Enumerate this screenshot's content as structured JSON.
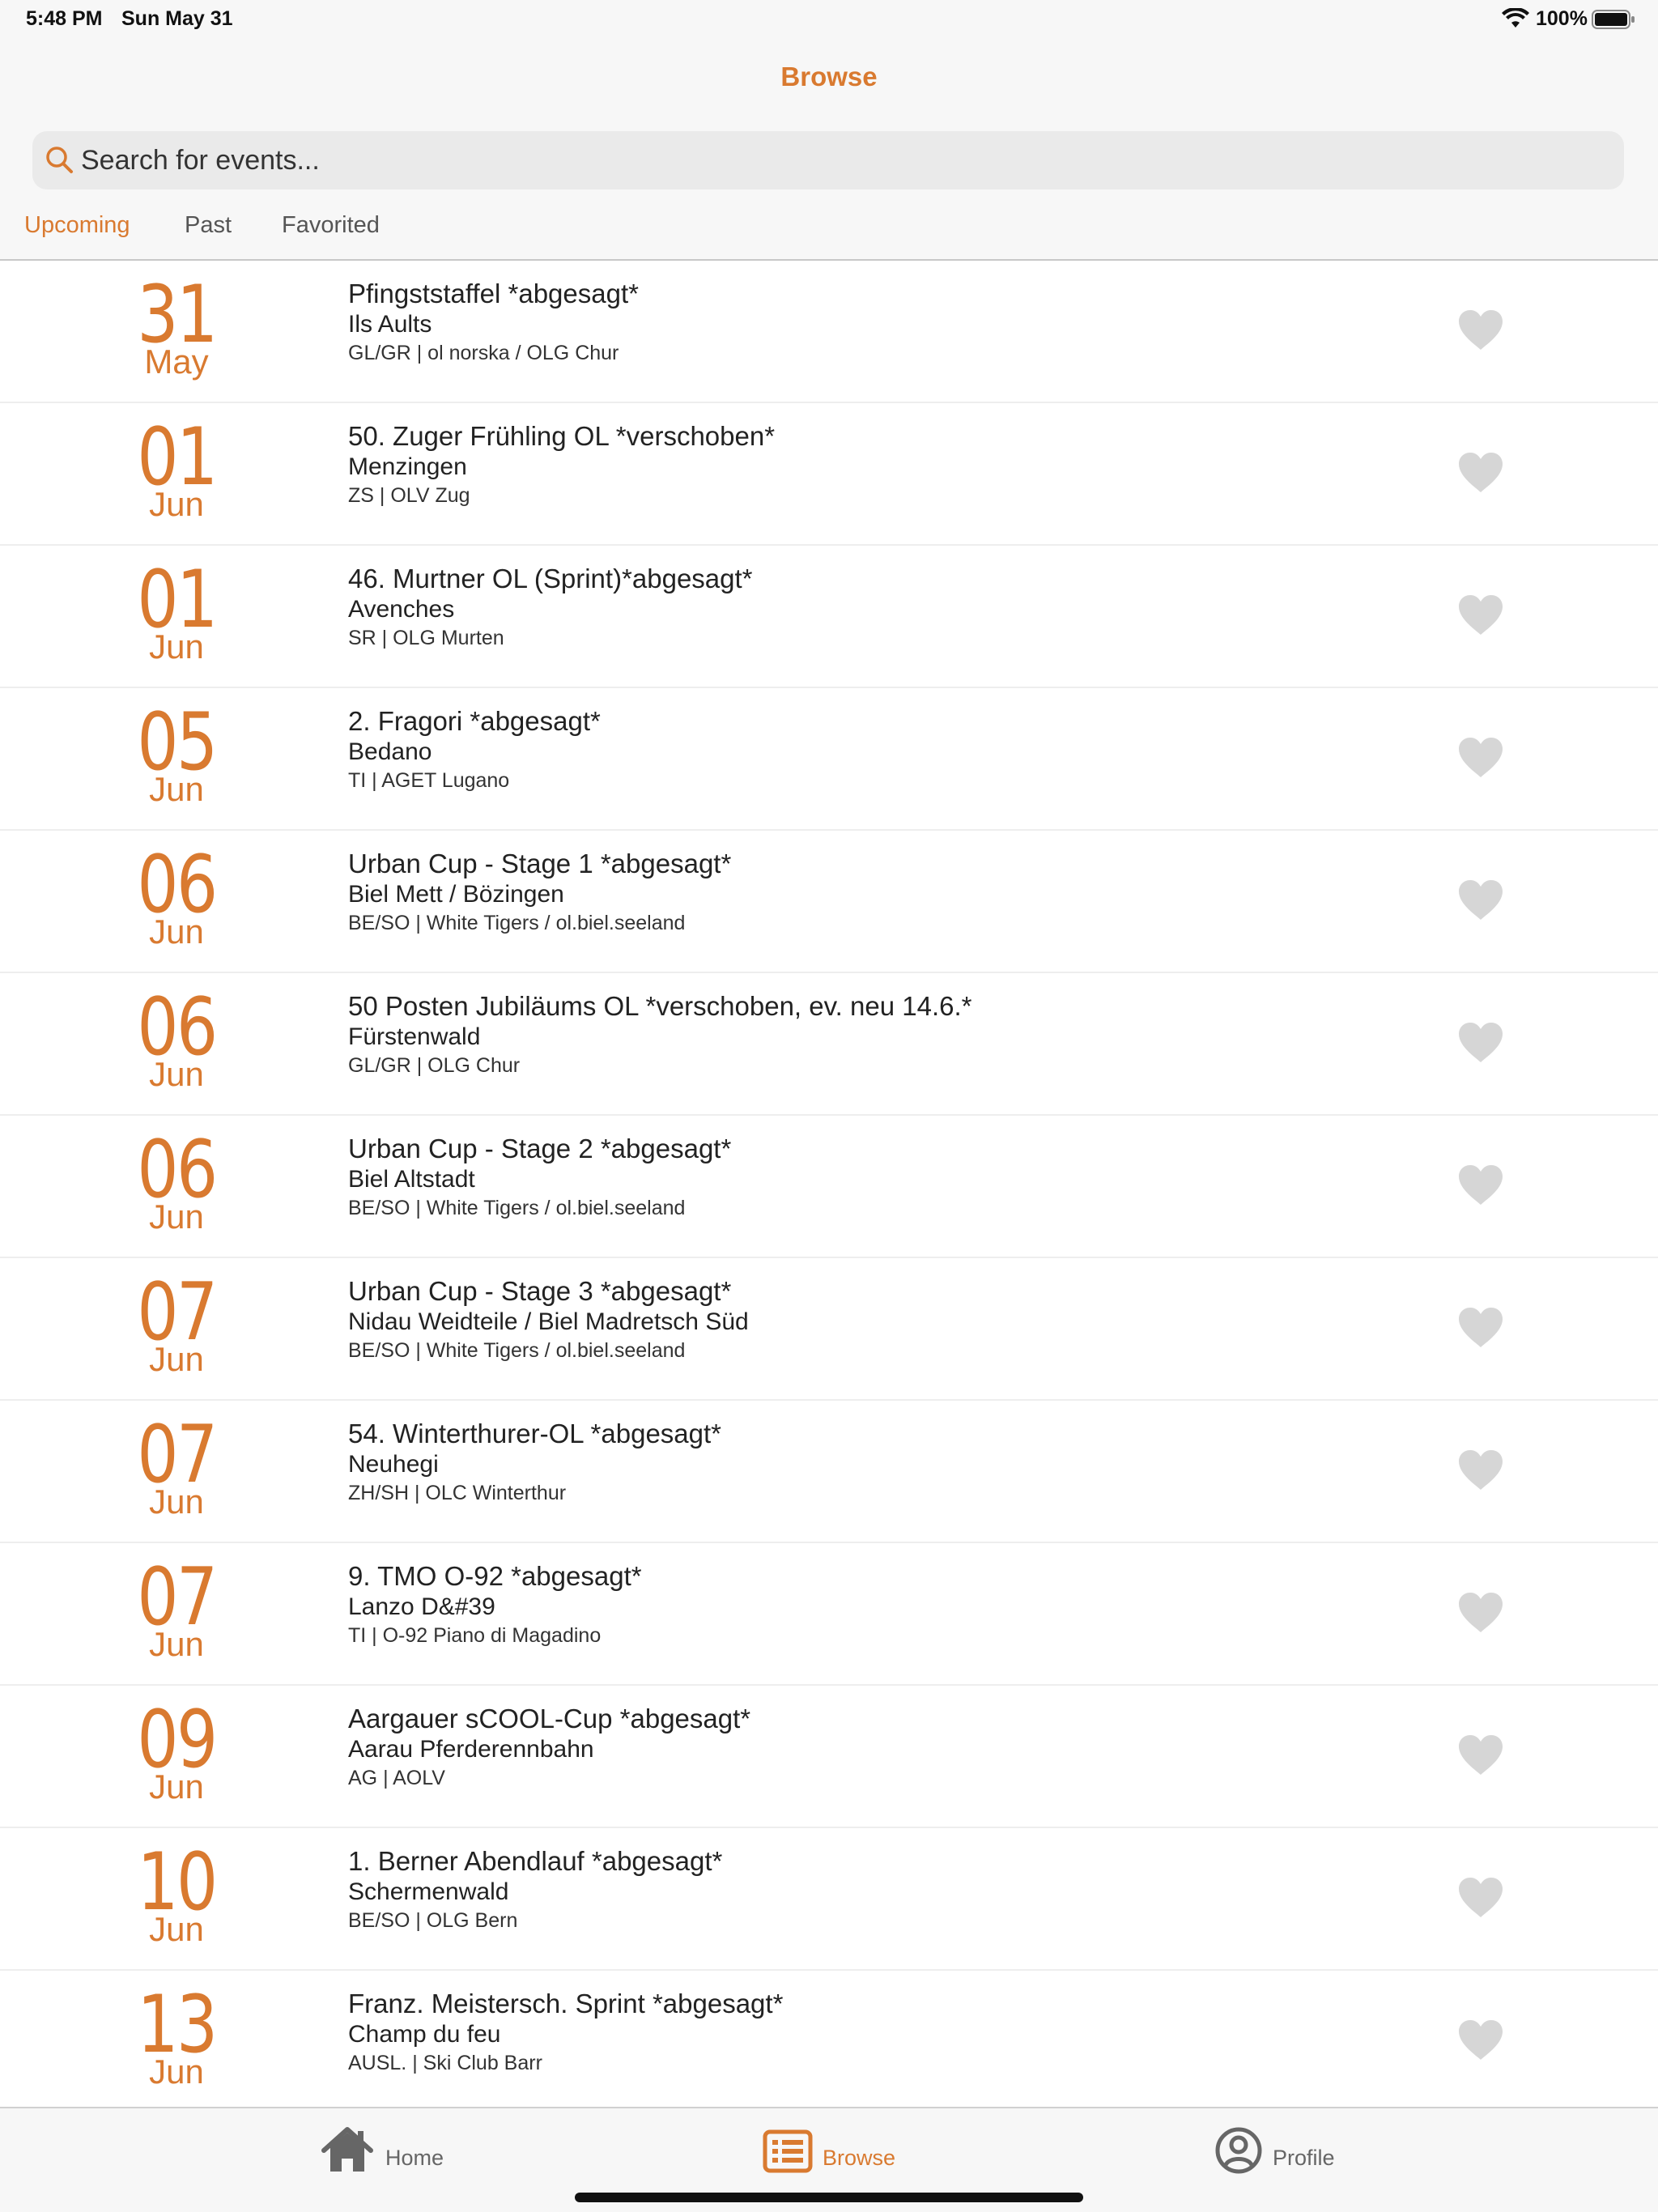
{
  "status_bar": {
    "time": "5:48 PM",
    "date": "Sun May 31",
    "battery": "100%"
  },
  "nav": {
    "title": "Browse"
  },
  "search": {
    "placeholder": "Search for events..."
  },
  "segments": [
    "Upcoming",
    "Past",
    "Favorited"
  ],
  "events": [
    {
      "day": "31",
      "month": "May",
      "title": "Pfingststaffel *abgesagt*",
      "location": "Ils Aults",
      "org": "GL/GR | ol norska / OLG Chur"
    },
    {
      "day": "01",
      "month": "Jun",
      "title": "50. Zuger Frühling OL  *verschoben*",
      "location": "Menzingen",
      "org": "ZS | OLV Zug"
    },
    {
      "day": "01",
      "month": "Jun",
      "title": "46. Murtner OL (Sprint)*abgesagt*",
      "location": "Avenches",
      "org": "SR | OLG Murten"
    },
    {
      "day": "05",
      "month": "Jun",
      "title": "2. Fragori *abgesagt*",
      "location": "Bedano",
      "org": "TI | AGET Lugano"
    },
    {
      "day": "06",
      "month": "Jun",
      "title": "Urban Cup - Stage 1 *abgesagt*",
      "location": "Biel Mett / Bözingen",
      "org": "BE/SO | White Tigers / ol.biel.seeland"
    },
    {
      "day": "06",
      "month": "Jun",
      "title": "50 Posten Jubiläums OL *verschoben, ev. neu 14.6.*",
      "location": "Fürstenwald",
      "org": "GL/GR | OLG Chur"
    },
    {
      "day": "06",
      "month": "Jun",
      "title": "Urban Cup - Stage 2 *abgesagt*",
      "location": "Biel Altstadt",
      "org": "BE/SO | White Tigers / ol.biel.seeland"
    },
    {
      "day": "07",
      "month": "Jun",
      "title": "Urban Cup - Stage 3 *abgesagt*",
      "location": "Nidau Weidteile / Biel Madretsch Süd",
      "org": "BE/SO | White Tigers / ol.biel.seeland"
    },
    {
      "day": "07",
      "month": "Jun",
      "title": "54. Winterthurer-OL *abgesagt*",
      "location": "Neuhegi",
      "org": "ZH/SH | OLC Winterthur"
    },
    {
      "day": "07",
      "month": "Jun",
      "title": "9. TMO O-92 *abgesagt*",
      "location": "Lanzo D&#39",
      "org": "TI | O-92 Piano di Magadino"
    },
    {
      "day": "09",
      "month": "Jun",
      "title": "Aargauer sCOOL-Cup *abgesagt*",
      "location": "Aarau Pferderennbahn",
      "org": "AG | AOLV"
    },
    {
      "day": "10",
      "month": "Jun",
      "title": "1. Berner Abendlauf *abgesagt*",
      "location": "Schermenwald",
      "org": "BE/SO | OLG Bern"
    },
    {
      "day": "13",
      "month": "Jun",
      "title": "Franz. Meistersch. Sprint  *abgesagt*",
      "location": "Champ du feu",
      "org": "AUSL. | Ski Club Barr"
    }
  ],
  "tabbar": {
    "home": "Home",
    "browse": "Browse",
    "profile": "Profile"
  },
  "colors": {
    "accent": "#d97a30",
    "heart": "#d6d6d6",
    "tab_inactive": "#666666"
  }
}
